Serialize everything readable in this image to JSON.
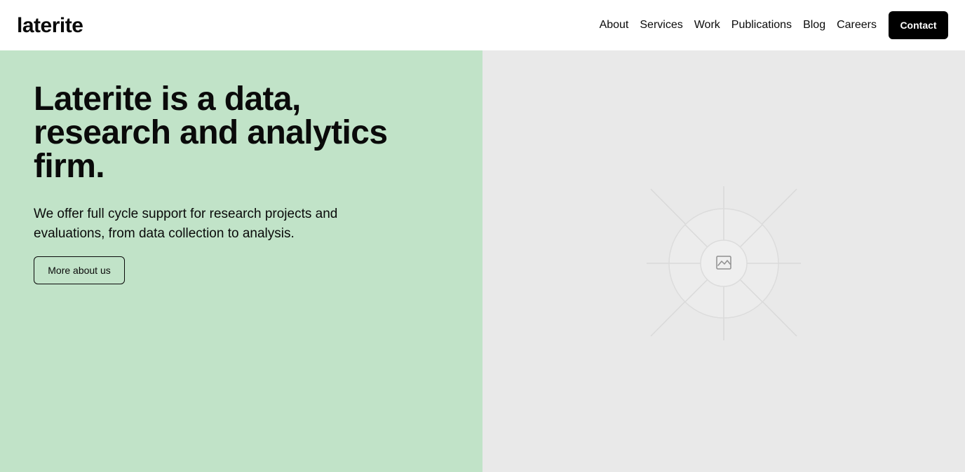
{
  "brand": {
    "logo_text": "laterite"
  },
  "nav": {
    "links": [
      "About",
      "Services",
      "Work",
      "Publications",
      "Blog",
      "Careers"
    ],
    "contact_label": "Contact"
  },
  "hero": {
    "title": "Laterite is a data, research and analytics firm.",
    "subtitle": "We offer full cycle support for research projects and evaluations, from data collection to analysis.",
    "cta_label": "More about us",
    "image_icon": "image-placeholder-icon"
  },
  "colors": {
    "hero_left_bg": "#c1e3c8",
    "hero_right_bg": "#e9e9e9",
    "contact_bg": "#000000"
  }
}
